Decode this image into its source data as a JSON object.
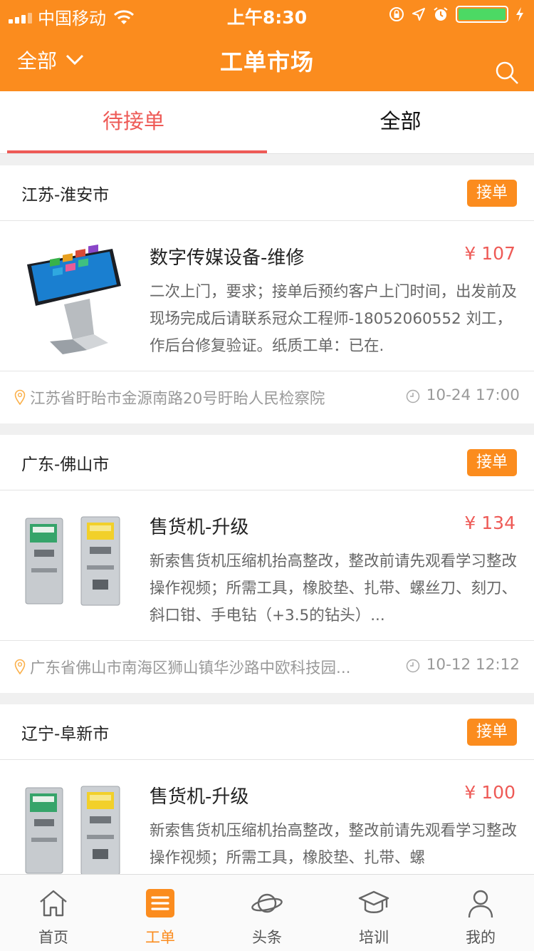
{
  "status_bar": {
    "carrier": "中国移动",
    "time": "上午8:30"
  },
  "nav": {
    "filter_label": "全部",
    "title": "工单市场"
  },
  "tabs": [
    {
      "label": "待接单",
      "active": true
    },
    {
      "label": "全部",
      "active": false
    }
  ],
  "orders": [
    {
      "region": "江苏-淮安市",
      "action": "接单",
      "image": "kiosk-touchscreen",
      "title": "数字传媒设备-维修",
      "price": "¥ 107",
      "description": "二次上门，要求；接单后预约客户上门时间，出发前及现场完成后请联系冠众工程师-18052060552 刘工，作后台修复验证。纸质工单：已在.",
      "address": "江苏省盱眙市金源南路20号盱眙人民检察院",
      "time": "10-24 17:00"
    },
    {
      "region": "广东-佛山市",
      "action": "接单",
      "image": "vending-machines",
      "title": "售货机-升级",
      "price": "¥ 134",
      "description": "新索售货机压缩机抬高整改，整改前请先观看学习整改操作视频；所需工具，橡胶垫、扎带、螺丝刀、刻刀、斜口钳、手电钻（+3.5的钻头）...",
      "address": "广东省佛山市南海区狮山镇华沙路中欧科技园...",
      "time": "10-12 12:12"
    },
    {
      "region": "辽宁-阜新市",
      "action": "接单",
      "image": "vending-machines",
      "title": "售货机-升级",
      "price": "¥ 100",
      "description": "新索售货机压缩机抬高整改，整改前请先观看学习整改操作视频；所需工具，橡胶垫、扎带、螺",
      "address": "",
      "time": ""
    }
  ],
  "tab_bar": [
    {
      "label": "首页",
      "icon": "home-icon",
      "active": false
    },
    {
      "label": "工单",
      "icon": "list-icon",
      "active": true
    },
    {
      "label": "头条",
      "icon": "planet-icon",
      "active": false
    },
    {
      "label": "培训",
      "icon": "graduation-cap-icon",
      "active": false
    },
    {
      "label": "我的",
      "icon": "person-icon",
      "active": false
    }
  ],
  "colors": {
    "brand": "#fb8c1e",
    "accent_red": "#ee5a56",
    "battery": "#4cd964"
  }
}
